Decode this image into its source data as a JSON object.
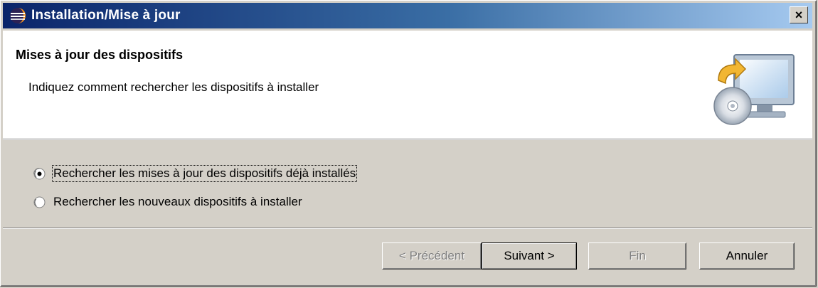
{
  "window": {
    "title": "Installation/Mise à jour",
    "close_symbol": "×"
  },
  "banner": {
    "title": "Mises à jour des dispositifs",
    "description": "Indiquez comment rechercher les dispositifs à installer",
    "image_icon": "computer-cd-update-icon"
  },
  "options": [
    {
      "label": "Rechercher les mises à jour des dispositifs déjà installés",
      "selected": true
    },
    {
      "label": "Rechercher les nouveaux dispositifs à installer",
      "selected": false
    }
  ],
  "buttons": {
    "previous": "< Précédent",
    "next": "Suivant >",
    "finish": "Fin",
    "cancel": "Annuler"
  },
  "colors": {
    "title_gradient_start": "#0a246a",
    "title_gradient_end": "#a6caf0",
    "face": "#d4d0c8"
  }
}
